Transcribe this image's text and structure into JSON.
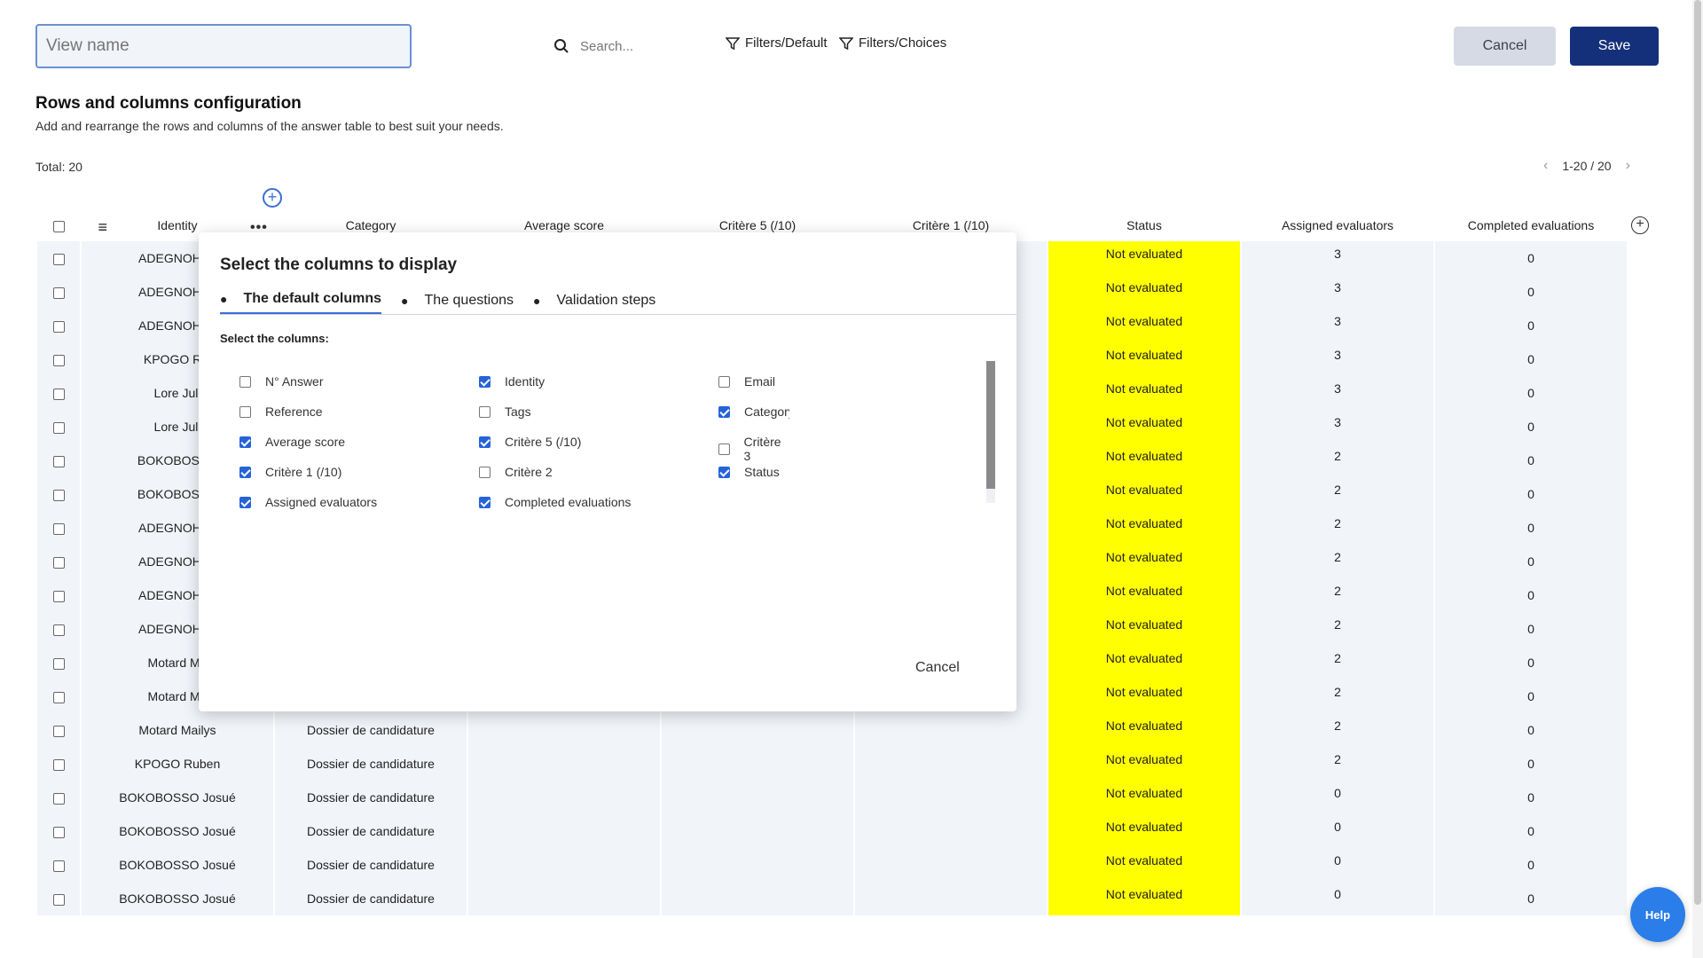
{
  "header": {
    "view_name_placeholder": "View name",
    "search_placeholder": "Search...",
    "filter_default": "Filters/Default",
    "filter_choices": "Filters/Choices",
    "cancel_label": "Cancel",
    "save_label": "Save"
  },
  "section": {
    "title": "Rows and columns configuration",
    "subtitle": "Add and rearrange the rows and columns of the answer table to best suit your needs.",
    "total": "Total: 20",
    "pagination": "1-20 / 20"
  },
  "table": {
    "headers": [
      "Identity",
      "Category",
      "Average score",
      "Critère 5 (/10)",
      "Critère 1 (/10)",
      "Status",
      "Assigned evaluators",
      "Completed evaluations"
    ],
    "rows": [
      {
        "identity": "ADEGNOH Ar",
        "category": "",
        "status": "Not evaluated",
        "assigned": "3",
        "completed": "0"
      },
      {
        "identity": "ADEGNOH Ar",
        "category": "",
        "status": "Not evaluated",
        "assigned": "3",
        "completed": "0"
      },
      {
        "identity": "ADEGNOH Ar",
        "category": "",
        "status": "Not evaluated",
        "assigned": "3",
        "completed": "0"
      },
      {
        "identity": "KPOGO Rul",
        "category": "",
        "status": "Not evaluated",
        "assigned": "3",
        "completed": "0"
      },
      {
        "identity": "Lore Juli",
        "category": "",
        "status": "Not evaluated",
        "assigned": "3",
        "completed": "0"
      },
      {
        "identity": "Lore Juli",
        "category": "",
        "status": "Not evaluated",
        "assigned": "3",
        "completed": "0"
      },
      {
        "identity": "BOKOBOSSO",
        "category": "",
        "status": "Not evaluated",
        "assigned": "2",
        "completed": "0"
      },
      {
        "identity": "BOKOBOSSO",
        "category": "",
        "status": "Not evaluated",
        "assigned": "2",
        "completed": "0"
      },
      {
        "identity": "ADEGNOH Ar",
        "category": "",
        "status": "Not evaluated",
        "assigned": "2",
        "completed": "0"
      },
      {
        "identity": "ADEGNOH Ar",
        "category": "",
        "status": "Not evaluated",
        "assigned": "2",
        "completed": "0"
      },
      {
        "identity": "ADEGNOH Ar",
        "category": "",
        "status": "Not evaluated",
        "assigned": "2",
        "completed": "0"
      },
      {
        "identity": "ADEGNOH Ar",
        "category": "",
        "status": "Not evaluated",
        "assigned": "2",
        "completed": "0"
      },
      {
        "identity": "Motard Ma",
        "category": "",
        "status": "Not evaluated",
        "assigned": "2",
        "completed": "0"
      },
      {
        "identity": "Motard Ma",
        "category": "",
        "status": "Not evaluated",
        "assigned": "2",
        "completed": "0"
      },
      {
        "identity": "Motard Mailys",
        "category": "Dossier de candidature",
        "status": "Not evaluated",
        "assigned": "2",
        "completed": "0"
      },
      {
        "identity": "KPOGO Ruben",
        "category": "Dossier de candidature",
        "status": "Not evaluated",
        "assigned": "2",
        "completed": "0"
      },
      {
        "identity": "BOKOBOSSO Josué",
        "category": "Dossier de candidature",
        "status": "Not evaluated",
        "assigned": "0",
        "completed": "0"
      },
      {
        "identity": "BOKOBOSSO Josué",
        "category": "Dossier de candidature",
        "status": "Not evaluated",
        "assigned": "0",
        "completed": "0"
      },
      {
        "identity": "BOKOBOSSO Josué",
        "category": "Dossier de candidature",
        "status": "Not evaluated",
        "assigned": "0",
        "completed": "0"
      },
      {
        "identity": "BOKOBOSSO Josué",
        "category": "Dossier de candidature",
        "status": "Not evaluated",
        "assigned": "0",
        "completed": "0"
      }
    ]
  },
  "modal": {
    "title": "Select the columns to display",
    "tabs": [
      "The default columns",
      "The questions",
      "Validation steps"
    ],
    "select_label": "Select the columns:",
    "columns": [
      {
        "label": "N° Answer",
        "checked": false
      },
      {
        "label": "Identity",
        "checked": true
      },
      {
        "label": "Email",
        "checked": false
      },
      {
        "label": "Reference",
        "checked": false
      },
      {
        "label": "Tags",
        "checked": false
      },
      {
        "label": "Category",
        "checked": true
      },
      {
        "label": "Average score",
        "checked": true
      },
      {
        "label": "Critère 5 (/10)",
        "checked": true
      },
      {
        "label": "Critère 3",
        "checked": false
      },
      {
        "label": "Critère 1 (/10)",
        "checked": true
      },
      {
        "label": "Critère 2",
        "checked": false
      },
      {
        "label": "Status",
        "checked": true
      },
      {
        "label": "Assigned evaluators",
        "checked": true
      },
      {
        "label": "Completed evaluations",
        "checked": true
      }
    ],
    "cancel_label": "Cancel"
  },
  "help_label": "Help",
  "colors": {
    "primary": "#15307a",
    "accent": "#3b6fd8",
    "status_bg": "#ffff00",
    "row_bg": "#f1f4f9"
  }
}
